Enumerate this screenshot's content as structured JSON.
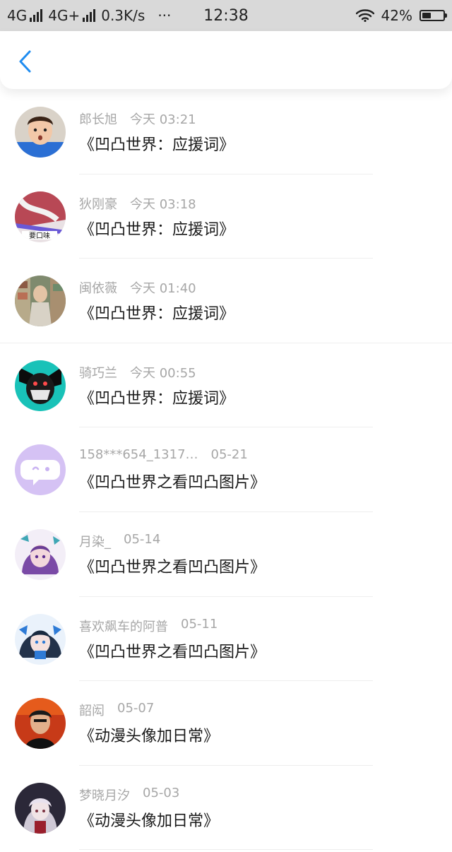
{
  "status_bar": {
    "signal1": "4G",
    "signal2": "4G+",
    "speed": "0.3K/s",
    "more": "···",
    "time": "12:38",
    "battery_percent": "42%",
    "battery_level": 0.42
  },
  "nav": {
    "back_icon": "chevron-left-icon",
    "accent_color": "#1f8cf0"
  },
  "items": [
    {
      "name": "郎长旭",
      "time": "今天 03:21",
      "title": "《凹凸世界：应援词》"
    },
    {
      "name": "狄刚豪",
      "time": "今天 03:18",
      "title": "《凹凸世界：应援词》"
    },
    {
      "name": "闽依薇",
      "time": "今天 01:40",
      "title": "《凹凸世界：应援词》"
    },
    {
      "name": "骑巧兰",
      "time": "今天 00:55",
      "title": "《凹凸世界：应援词》"
    },
    {
      "name": "158***654_1317…",
      "time": "05-21",
      "title": "《凹凸世界之看凹凸图片》"
    },
    {
      "name": "月染_",
      "time": "05-14",
      "title": "《凹凸世界之看凹凸图片》"
    },
    {
      "name": "喜欢飙车的阿普",
      "time": "05-11",
      "title": "《凹凸世界之看凹凸图片》"
    },
    {
      "name": "韶闳",
      "time": "05-07",
      "title": "《动漫头像加日常》"
    },
    {
      "name": "梦晓月汐",
      "time": "05-03",
      "title": "《动漫头像加日常》"
    }
  ]
}
